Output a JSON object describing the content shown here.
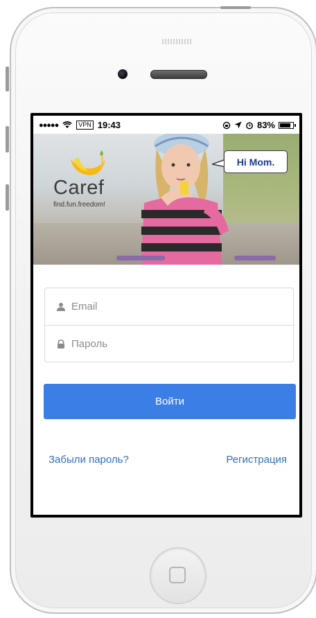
{
  "status_bar": {
    "signal": "●●●●●",
    "vpn": "VPN",
    "time": "19:43",
    "battery_percent": "83%",
    "battery_level": 0.83
  },
  "hero": {
    "brand_name": "Caref",
    "tagline": "find.fun.freedom!",
    "speech_bubble": "Hi Mom."
  },
  "login": {
    "email_placeholder": "Email",
    "password_placeholder": "Пароль",
    "submit_label": "Войти",
    "forgot_password": "Забыли пароль?",
    "register": "Регистрация"
  },
  "colors": {
    "accent": "#3a7ee6",
    "link": "#2f6fc4",
    "bubble_text": "#1b3a8c"
  },
  "icons": {
    "email_field": "user-icon",
    "password_field": "lock-icon",
    "wifi": "wifi-icon",
    "location": "location-arrow-icon",
    "alarm": "alarm-icon",
    "rotation_lock": "rotation-lock-icon"
  }
}
